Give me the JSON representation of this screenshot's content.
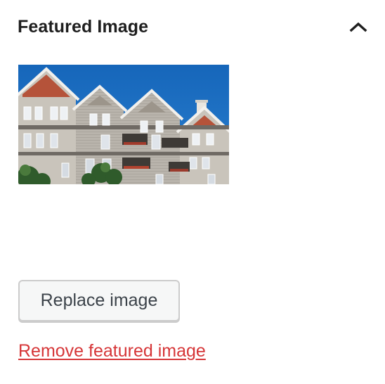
{
  "panel": {
    "title": "Featured Image",
    "toggle_icon": "chevron-up-icon"
  },
  "image": {
    "alt": "Featured image thumbnail: apartment building against blue sky"
  },
  "actions": {
    "replace_label": "Replace image",
    "remove_label": "Remove featured image"
  },
  "colors": {
    "title": "#1e1e1e",
    "button_bg": "#f6f7f7",
    "button_border": "#cccccc",
    "button_text": "#3c434a",
    "remove_link": "#d63638",
    "sky": "#1a6fc0"
  }
}
